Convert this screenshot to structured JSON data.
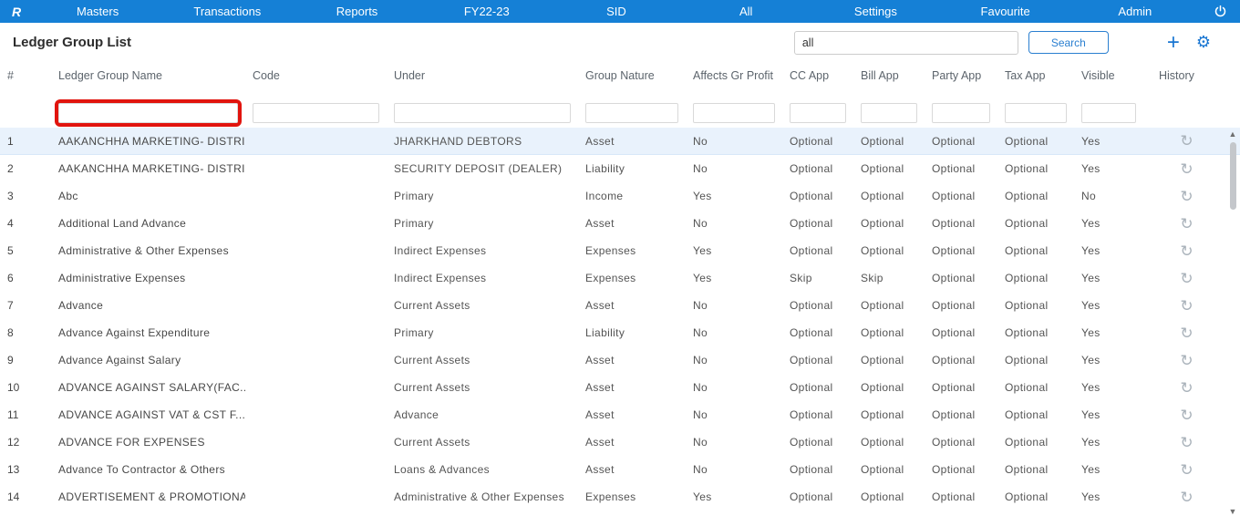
{
  "topbar": {
    "logo_text": "R",
    "menu": [
      "Masters",
      "Transactions",
      "Reports",
      "FY22-23",
      "SID",
      "All",
      "Settings",
      "Favourite",
      "Admin"
    ]
  },
  "header": {
    "title": "Ledger Group List",
    "search_value": "all",
    "search_button_label": "Search"
  },
  "icons": {
    "plus": "+",
    "gear": "⚙",
    "history": "↺",
    "scroll_up": "▲",
    "scroll_down": "▼"
  },
  "colors": {
    "topbar_blue": "#1580d6",
    "accent_blue": "#1976d2",
    "selected_row": "#e9f2fc",
    "annotation_red": "#e1140e"
  },
  "annotation": {
    "highlighted_element": "ledger-group-name-filter"
  },
  "table": {
    "selected_row_index": 0,
    "columns": [
      "#",
      "Ledger Group Name",
      "Code",
      "Under",
      "Group Nature",
      "Affects Gr Profit",
      "CC App",
      "Bill App",
      "Party App",
      "Tax App",
      "Visible",
      "History"
    ],
    "rows": [
      {
        "num": "1",
        "name": "AAKANCHHA MARKETING- DISTRI...",
        "code": "",
        "under": "JHARKHAND DEBTORS",
        "nature": "Asset",
        "affects": "No",
        "cc": "Optional",
        "bill": "Optional",
        "party": "Optional",
        "tax": "Optional",
        "visible": "Yes"
      },
      {
        "num": "2",
        "name": "AAKANCHHA MARKETING- DISTRI...",
        "code": "",
        "under": "SECURITY DEPOSIT (DEALER)",
        "nature": "Liability",
        "affects": "No",
        "cc": "Optional",
        "bill": "Optional",
        "party": "Optional",
        "tax": "Optional",
        "visible": "Yes"
      },
      {
        "num": "3",
        "name": "Abc",
        "code": "",
        "under": "Primary",
        "nature": "Income",
        "affects": "Yes",
        "cc": "Optional",
        "bill": "Optional",
        "party": "Optional",
        "tax": "Optional",
        "visible": "No"
      },
      {
        "num": "4",
        "name": "Additional Land Advance",
        "code": "",
        "under": "Primary",
        "nature": "Asset",
        "affects": "No",
        "cc": "Optional",
        "bill": "Optional",
        "party": "Optional",
        "tax": "Optional",
        "visible": "Yes"
      },
      {
        "num": "5",
        "name": "Administrative & Other Expenses",
        "code": "",
        "under": "Indirect Expenses",
        "nature": "Expenses",
        "affects": "Yes",
        "cc": "Optional",
        "bill": "Optional",
        "party": "Optional",
        "tax": "Optional",
        "visible": "Yes"
      },
      {
        "num": "6",
        "name": "Administrative Expenses",
        "code": "",
        "under": "Indirect Expenses",
        "nature": "Expenses",
        "affects": "Yes",
        "cc": "Skip",
        "bill": "Skip",
        "party": "Optional",
        "tax": "Optional",
        "visible": "Yes"
      },
      {
        "num": "7",
        "name": "Advance",
        "code": "",
        "under": "Current Assets",
        "nature": "Asset",
        "affects": "No",
        "cc": "Optional",
        "bill": "Optional",
        "party": "Optional",
        "tax": "Optional",
        "visible": "Yes"
      },
      {
        "num": "8",
        "name": "Advance Against Expenditure",
        "code": "",
        "under": "Primary",
        "nature": "Liability",
        "affects": "No",
        "cc": "Optional",
        "bill": "Optional",
        "party": "Optional",
        "tax": "Optional",
        "visible": "Yes"
      },
      {
        "num": "9",
        "name": "Advance Against Salary",
        "code": "",
        "under": "Current Assets",
        "nature": "Asset",
        "affects": "No",
        "cc": "Optional",
        "bill": "Optional",
        "party": "Optional",
        "tax": "Optional",
        "visible": "Yes"
      },
      {
        "num": "10",
        "name": "ADVANCE AGAINST SALARY(FAC...",
        "code": "",
        "under": "Current Assets",
        "nature": "Asset",
        "affects": "No",
        "cc": "Optional",
        "bill": "Optional",
        "party": "Optional",
        "tax": "Optional",
        "visible": "Yes"
      },
      {
        "num": "11",
        "name": "ADVANCE AGAINST VAT & CST F...",
        "code": "",
        "under": "Advance",
        "nature": "Asset",
        "affects": "No",
        "cc": "Optional",
        "bill": "Optional",
        "party": "Optional",
        "tax": "Optional",
        "visible": "Yes"
      },
      {
        "num": "12",
        "name": "ADVANCE FOR EXPENSES",
        "code": "",
        "under": "Current Assets",
        "nature": "Asset",
        "affects": "No",
        "cc": "Optional",
        "bill": "Optional",
        "party": "Optional",
        "tax": "Optional",
        "visible": "Yes"
      },
      {
        "num": "13",
        "name": "Advance To Contractor & Others",
        "code": "",
        "under": "Loans & Advances",
        "nature": "Asset",
        "affects": "No",
        "cc": "Optional",
        "bill": "Optional",
        "party": "Optional",
        "tax": "Optional",
        "visible": "Yes"
      },
      {
        "num": "14",
        "name": "ADVERTISEMENT & PROMOTIONA...",
        "code": "",
        "under": "Administrative & Other Expenses",
        "nature": "Expenses",
        "affects": "Yes",
        "cc": "Optional",
        "bill": "Optional",
        "party": "Optional",
        "tax": "Optional",
        "visible": "Yes"
      }
    ]
  }
}
